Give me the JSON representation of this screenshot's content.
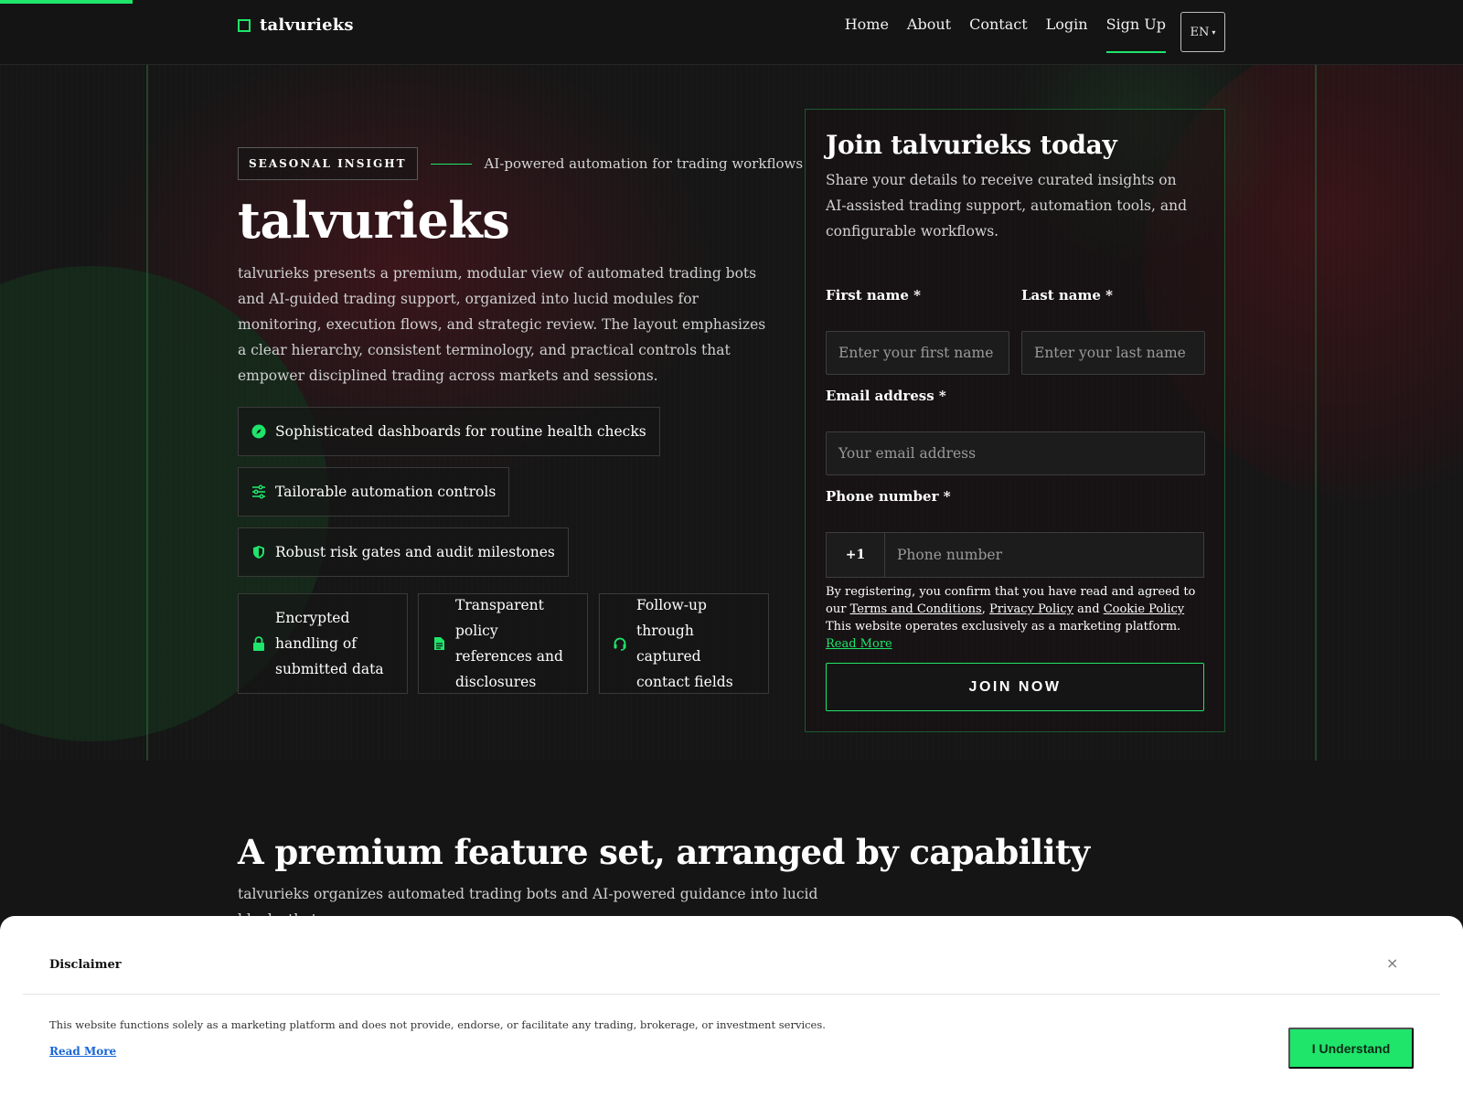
{
  "header": {
    "brand": "talvurieks",
    "nav": [
      "Home",
      "About",
      "Contact",
      "Login",
      "Sign Up"
    ],
    "language": "EN"
  },
  "hero": {
    "badge": "SEASONAL INSIGHT",
    "tagline": "AI-powered automation for trading workflows",
    "title": "talvurieks",
    "description": "talvurieks presents a premium, modular view of automated trading bots and AI-guided trading support, organized into lucid modules for monitoring, execution flows, and strategic review. The layout emphasizes a clear hierarchy, consistent terminology, and practical controls that empower disciplined trading across markets and sessions.",
    "features": [
      {
        "icon": "compass-icon",
        "label": "Sophisticated dashboards for routine health checks"
      },
      {
        "icon": "sliders-icon",
        "label": "Tailorable automation controls"
      },
      {
        "icon": "shield-icon",
        "label": "Robust risk gates and audit milestones"
      }
    ],
    "cards": [
      {
        "icon": "lock-icon",
        "label": "Encrypted handling of submitted data"
      },
      {
        "icon": "document-icon",
        "label": "Transparent policy references and disclosures"
      },
      {
        "icon": "headset-icon",
        "label": "Follow-up through captured contact fields"
      }
    ]
  },
  "form": {
    "title": "Join talvurieks today",
    "description": "Share your details to receive curated insights on AI-assisted trading support, automation tools, and configurable workflows.",
    "first_name_label": "First name *",
    "first_name_placeholder": "Enter your first name",
    "last_name_label": "Last name *",
    "last_name_placeholder": "Enter your last name",
    "email_label": "Email address *",
    "email_placeholder": "Your email address",
    "phone_label": "Phone number *",
    "phone_code": "+1",
    "phone_placeholder": "Phone number",
    "legal_prefix": "By registering, you confirm that you have read and agreed to our",
    "terms": "Terms and Conditions",
    "privacy": "Privacy Policy",
    "and": "and",
    "cookie": "Cookie Policy",
    "legal_suffix": "This website operates exclusively as a marketing platform.",
    "read_more": "Read More",
    "submit": "JOIN NOW"
  },
  "section2": {
    "title": "A premium feature set, arranged by capability",
    "description": "talvurieks organizes automated trading bots and AI-powered guidance into lucid blocks that"
  },
  "disclaimer": {
    "title": "Disclaimer",
    "text": "This website functions solely as a marketing platform and does not provide, endorse, or facilitate any trading, brokerage, or investment services.",
    "read_more": "Read More",
    "button": "I Understand",
    "close": "×"
  },
  "colors": {
    "accent": "#1fe56b",
    "background": "#151515"
  },
  "progress_fraction": 0.09
}
